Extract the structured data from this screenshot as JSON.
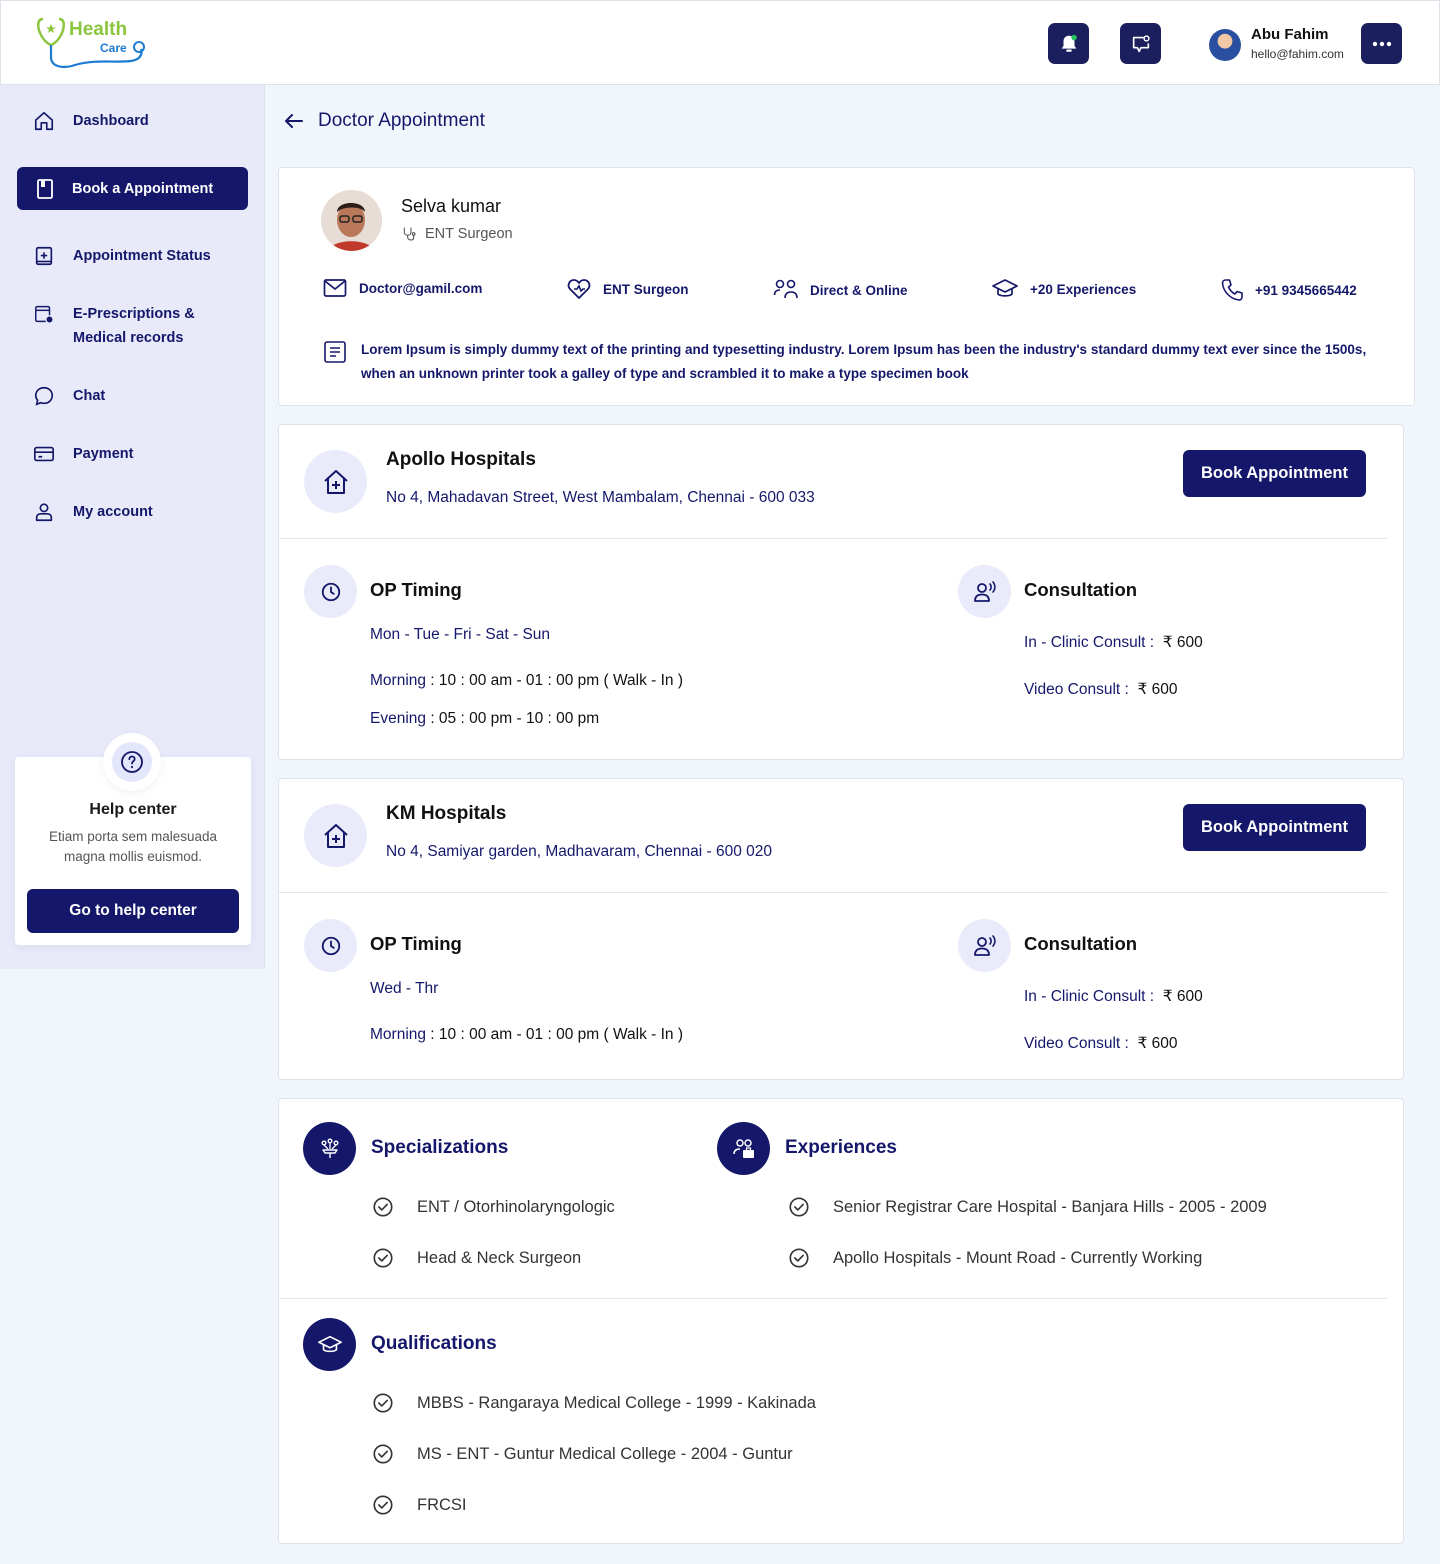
{
  "header": {
    "logo_primary": "Health",
    "logo_secondary": "Care",
    "user_name": "Abu Fahim",
    "user_email": "hello@fahim.com"
  },
  "sidebar": {
    "items": [
      {
        "label": "Dashboard"
      },
      {
        "label": "Book a Appointment"
      },
      {
        "label": "Appointment Status"
      },
      {
        "label": "E-Prescriptions &",
        "label2": "Medical records"
      },
      {
        "label": "Chat"
      },
      {
        "label": "Payment"
      },
      {
        "label": "My account"
      }
    ],
    "help": {
      "title": "Help center",
      "text": "Etiam porta sem malesuada magna mollis euismod.",
      "button": "Go to help center"
    }
  },
  "page": {
    "title": "Doctor Appointment"
  },
  "doctor": {
    "name": "Selva kumar",
    "specialty": "ENT Surgeon",
    "email": "Doctor@gamil.com",
    "specialty2": "ENT Surgeon",
    "mode": "Direct & Online",
    "experience": "+20 Experiences",
    "phone": "+91 9345665442",
    "description": "Lorem Ipsum is simply dummy text of the printing and typesetting industry. Lorem Ipsum has been the industry's standard dummy text ever since the 1500s, when an unknown printer took a galley of type and scrambled it to make a type specimen book"
  },
  "hospitals": [
    {
      "name": "Apollo Hospitals",
      "address": "No 4, Mahadavan Street, West Mambalam, Chennai - 600 033",
      "book_label": "Book Appointment",
      "op_title": "OP Timing",
      "days": "Mon - Tue - Fri - Sat - Sun",
      "morning_label": "Morning",
      "morning_value": " : 10 : 00 am - 01 : 00 pm  ( Walk - In )",
      "evening_label": "Evening",
      "evening_value": " : 05 : 00 pm - 10 : 00 pm",
      "consult_title": "Consultation",
      "clinic_label": "In - Clinic Consult :",
      "clinic_value": "₹ 600",
      "video_label": "Video Consult :",
      "video_value": "₹ 600"
    },
    {
      "name": "KM Hospitals",
      "address": "No 4, Samiyar garden, Madhavaram, Chennai - 600 020",
      "book_label": "Book Appointment",
      "op_title": "OP Timing",
      "days": "Wed - Thr",
      "morning_label": "Morning",
      "morning_value": " : 10 : 00 am - 01 : 00 pm  ( Walk - In )",
      "consult_title": "Consultation",
      "clinic_label": "In - Clinic Consult :",
      "clinic_value": "₹ 600",
      "video_label": "Video Consult :",
      "video_value": "₹ 600"
    }
  ],
  "specializations": {
    "title": "Specializations",
    "items": [
      "ENT / Otorhinolaryngologic",
      "Head & Neck Surgeon"
    ]
  },
  "experiences": {
    "title": "Experiences",
    "items": [
      "Senior Registrar Care Hospital - Banjara Hills - 2005 - 2009",
      "Apollo Hospitals - Mount Road - Currently Working"
    ]
  },
  "qualifications": {
    "title": "Qualifications",
    "items": [
      "MBBS - Rangaraya Medical College - 1999 - Kakinada",
      "MS - ENT - Guntur Medical College - 2004 - Guntur",
      "FRCSI"
    ]
  },
  "colors": {
    "primary": "#15186a",
    "accent_green": "#8cc63e",
    "accent_blue": "#1d7bd0",
    "background": "#f1f6fd"
  }
}
